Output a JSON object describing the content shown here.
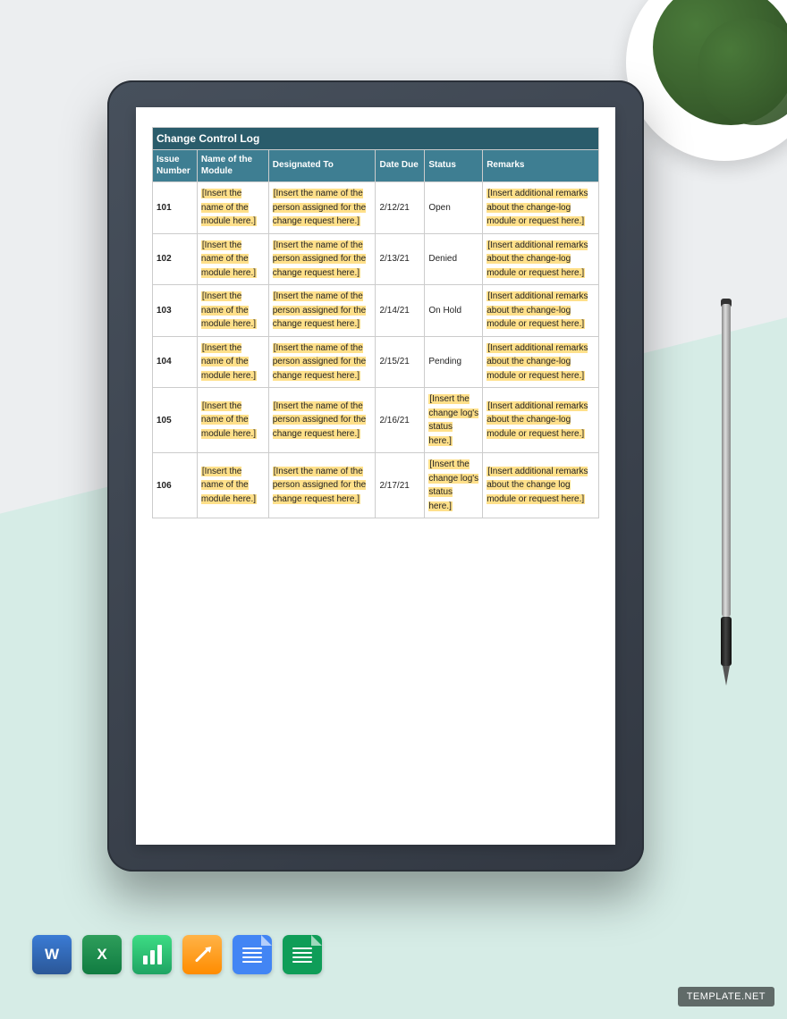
{
  "table": {
    "title": "Change Control Log",
    "headers": {
      "issue": "Issue Number",
      "module": "Name of the Module",
      "designated": "Designated To",
      "date": "Date Due",
      "status": "Status",
      "remarks": "Remarks"
    },
    "rows": [
      {
        "issue": "101",
        "module": "[Insert the name of the module here.]",
        "designated": "[Insert the name of the person assigned for the change request here.]",
        "date": "2/12/21",
        "status": "Open",
        "status_hl": false,
        "remarks": "[Insert additional remarks about the change-log module or request here.]"
      },
      {
        "issue": "102",
        "module": "[Insert the name of the module here.]",
        "designated": "[Insert the name of the person assigned for the change request here.]",
        "date": "2/13/21",
        "status": "Denied",
        "status_hl": false,
        "remarks": "[Insert additional remarks about the change-log module or request here.]"
      },
      {
        "issue": "103",
        "module": "[Insert the name of the module here.]",
        "designated": "[Insert the name of the person assigned for the change request here.]",
        "date": "2/14/21",
        "status": "On Hold",
        "status_hl": false,
        "remarks": "[Insert additional remarks about the change-log module or request here.]"
      },
      {
        "issue": "104",
        "module": "[Insert the name of the module here.]",
        "designated": "[Insert the name of the person assigned for the change request here.]",
        "date": "2/15/21",
        "status": "Pending",
        "status_hl": false,
        "remarks": "[Insert additional remarks about the change-log module or request here.]"
      },
      {
        "issue": "105",
        "module": "[Insert the name of the module here.]",
        "designated": "[Insert the name of the person assigned for the change request here.]",
        "date": "2/16/21",
        "status": "[Insert the change log's status here.]",
        "status_hl": true,
        "remarks": "[Insert additional remarks about the change-log module or request here.]"
      },
      {
        "issue": "106",
        "module": "[Insert the name of the module here.]",
        "designated": "[Insert the name of the person assigned for the change request here.]",
        "date": "2/17/21",
        "status": "[Insert the change log's status here.]",
        "status_hl": true,
        "remarks": "[Insert additional remarks about the change log module or request here.]"
      }
    ]
  },
  "apps": {
    "word": "W",
    "excel": "X"
  },
  "watermark": "TEMPLATE.NET"
}
